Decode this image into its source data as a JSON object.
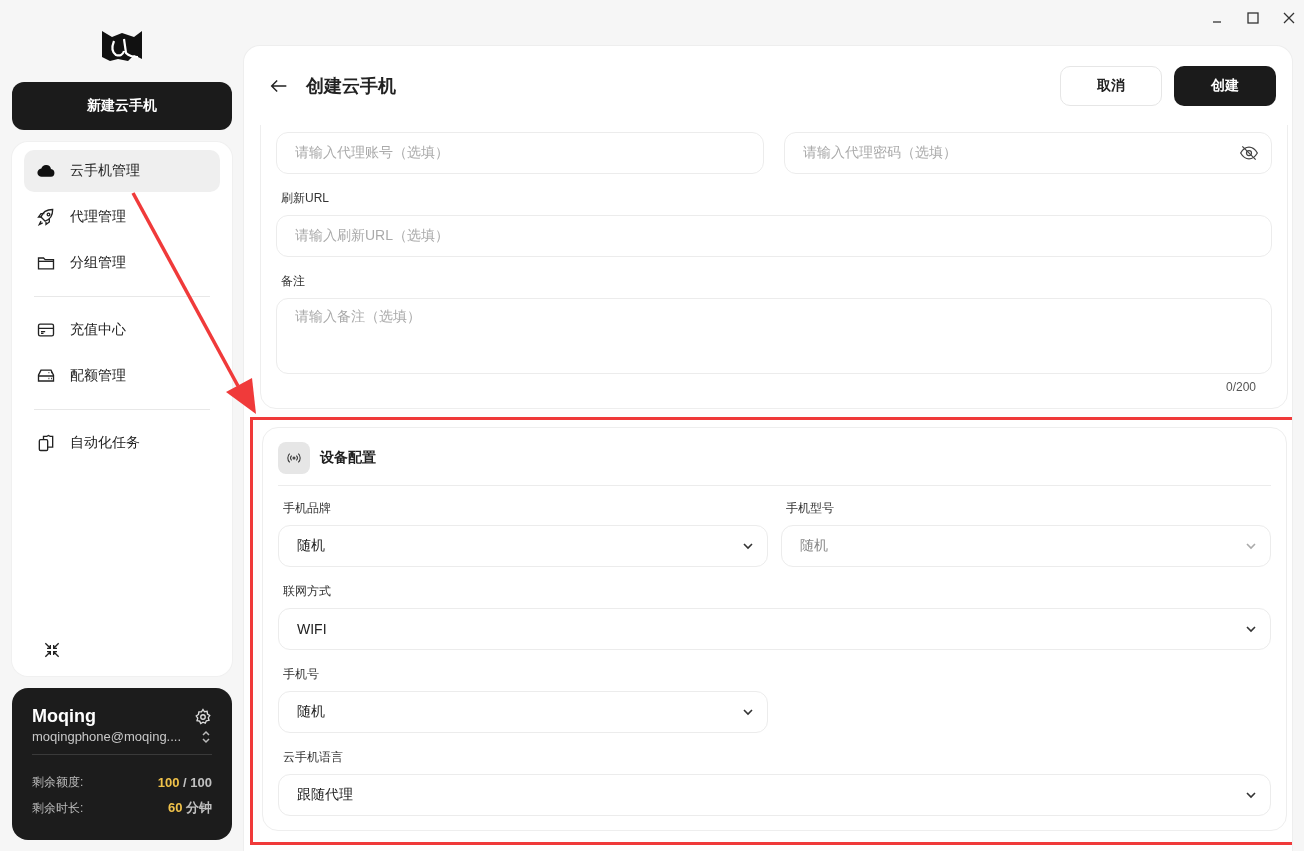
{
  "sidebar": {
    "new_button": "新建云手机",
    "nav_groups": [
      [
        {
          "label": "云手机管理",
          "selected": true
        },
        {
          "label": "代理管理",
          "selected": false
        },
        {
          "label": "分组管理",
          "selected": false
        }
      ],
      [
        {
          "label": "充值中心",
          "selected": false
        },
        {
          "label": "配额管理",
          "selected": false
        }
      ],
      [
        {
          "label": "自动化任务",
          "selected": false
        }
      ]
    ]
  },
  "account": {
    "name": "Moqing",
    "email": "moqingphone@moqing....",
    "stats": [
      {
        "label": "剩余额度:",
        "value": "100",
        "suffix": "/ 100"
      },
      {
        "label": "剩余时长:",
        "value": "60",
        "suffix": "分钟"
      }
    ]
  },
  "page": {
    "title": "创建云手机",
    "cancel": "取消",
    "create": "创建"
  },
  "proxy_section": {
    "rows": [
      [
        {
          "kind": "input",
          "placeholder": "请输入代理账号（选填）"
        },
        {
          "kind": "password",
          "placeholder": "请输入代理密码（选填）"
        }
      ],
      [
        {
          "label": "刷新URL",
          "kind": "input",
          "placeholder": "请输入刷新URL（选填）"
        }
      ],
      [
        {
          "label": "备注",
          "kind": "textarea",
          "placeholder": "请输入备注（选填）",
          "counter": "0/200"
        }
      ]
    ]
  },
  "device_section": {
    "title": "设备配置",
    "highlighted": true,
    "rows": [
      [
        {
          "label": "手机品牌",
          "value": "随机",
          "disabled": false
        },
        {
          "label": "手机型号",
          "value": "随机",
          "disabled": true
        }
      ],
      [
        {
          "label": "联网方式",
          "value": "WIFI",
          "disabled": false,
          "wide": true
        }
      ],
      [
        {
          "label": "手机号",
          "value": "随机",
          "disabled": false,
          "wide": false
        }
      ],
      [
        {
          "label": "云手机语言",
          "value": "跟随代理",
          "disabled": false,
          "wide": true
        }
      ]
    ]
  }
}
